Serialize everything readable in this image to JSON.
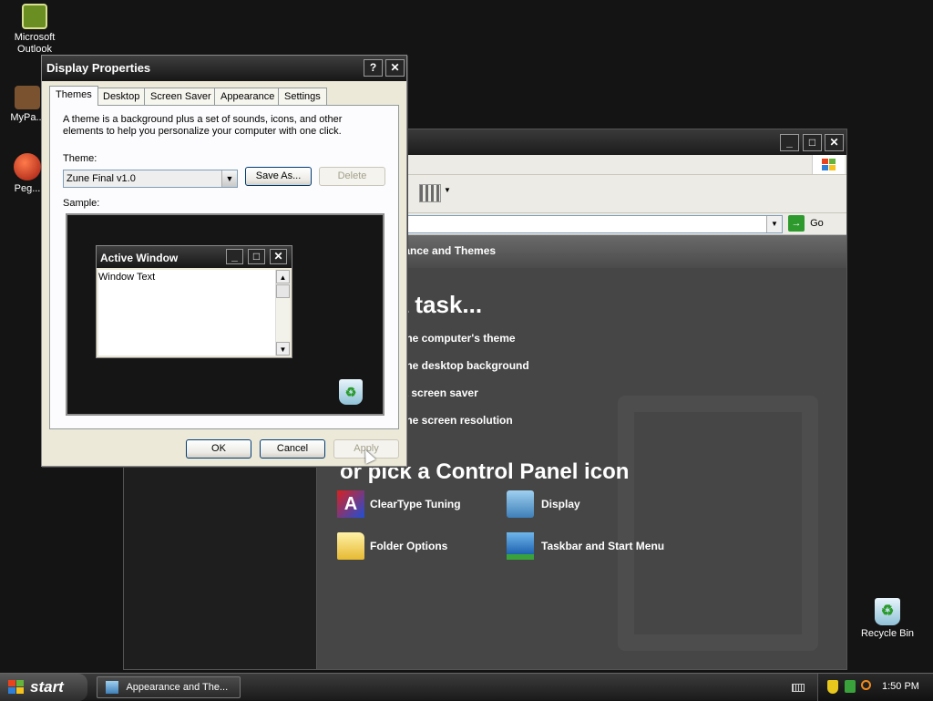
{
  "desktop": {
    "icons": [
      {
        "label": "Microsoft Outlook"
      },
      {
        "label": "MyPa..."
      },
      {
        "label": "Peg..."
      },
      {
        "label": "Recycle Bin"
      }
    ]
  },
  "control_panel": {
    "go_label": "Go",
    "header_title": "Appearance and Themes",
    "pick_task_heading": "Pick a task...",
    "tasks": [
      "Change the computer's theme",
      "Change the desktop background",
      "Choose a screen saver",
      "Change the screen resolution"
    ],
    "pick_icon_heading": "or pick a Control Panel icon",
    "icons": [
      {
        "label": "ClearType Tuning"
      },
      {
        "label": "Display"
      },
      {
        "label": "Folder Options"
      },
      {
        "label": "Taskbar and Start Menu"
      }
    ]
  },
  "dialog": {
    "title": "Display Properties",
    "help_glyph": "?",
    "close_glyph": "✕",
    "tabs": [
      "Themes",
      "Desktop",
      "Screen Saver",
      "Appearance",
      "Settings"
    ],
    "description": "A theme is a background plus a set of sounds, icons, and other elements to help you personalize your computer with one click.",
    "theme_label": "Theme:",
    "theme_value": "Zune Final v1.0",
    "save_as_label": "Save As...",
    "delete_label": "Delete",
    "sample_label": "Sample:",
    "sample_window_title": "Active Window",
    "sample_window_text": "Window Text",
    "ok_label": "OK",
    "cancel_label": "Cancel",
    "apply_label": "Apply"
  },
  "taskbar": {
    "start_label": "start",
    "task_label": "Appearance and The...",
    "clock": "1:50 PM"
  },
  "colors": {
    "accent_green": "#2e9a2e",
    "title_dark": "#1c1c1c"
  }
}
